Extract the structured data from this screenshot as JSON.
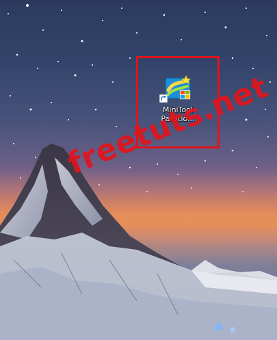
{
  "desktop": {
    "shortcut": {
      "label_line1": "MiniTool",
      "label_line2": "Partitio...",
      "icon": "minitool-partition-wizard-icon",
      "overlay_icon": "shortcut-arrow-icon"
    },
    "highlight_color": "#e0141e",
    "wallpaper_icon": "starry-mountain-wallpaper"
  },
  "watermark": {
    "text": "freetuts.net",
    "color": "#e2141c"
  }
}
